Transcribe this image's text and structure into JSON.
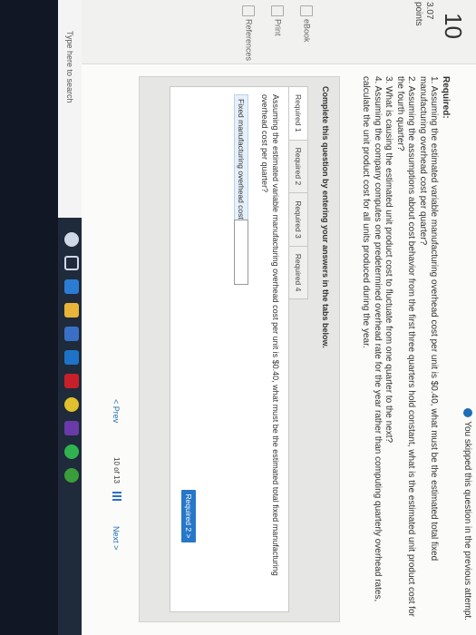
{
  "notice": "You skipped this question in the previous attempt.",
  "question": {
    "number": "10",
    "points": "3.07",
    "points_label": "points",
    "side_links": [
      "eBook",
      "Print",
      "References"
    ]
  },
  "required": {
    "heading": "Required:",
    "items": [
      "1. Assuming the estimated variable manufacturing overhead cost per unit is $0.40, what must be the estimated total fixed manufacturing overhead cost per quarter?",
      "2. Assuming the assumptions about cost behavior from the first three quarters hold constant, what is the estimated unit product cost for the fourth quarter?",
      "3. What is causing the estimated unit product cost to fluctuate from one quarter to the next?",
      "4. Assuming the company computes one predetermined overhead rate for the year rather than computing quarterly overhead rates, calculate the unit product cost for all units produced during the year."
    ]
  },
  "panel": {
    "instruction": "Complete this question by entering your answers in the tabs below.",
    "tabs": [
      "Required 1",
      "Required 2",
      "Required 3",
      "Required 4"
    ],
    "active_tab": 0,
    "question_text": "Assuming the estimated variable manufacturing overhead cost per unit is $0.40, what must be the estimated total fixed manufacturing overhead cost per quarter?",
    "field_label": "Fixed manufacturing overhead cost",
    "field_value": "",
    "next_tab_button": "Required 2  >"
  },
  "footer": {
    "prev": "< Prev",
    "page": "10",
    "of": "of",
    "total": "13",
    "next": "Next >"
  },
  "taskbar": {
    "search_placeholder": "Type here to search",
    "icons": [
      "cortana-icon",
      "task-view-icon",
      "edge-icon",
      "file-explorer-icon",
      "store-icon",
      "mail-icon",
      "mcgraw-hill-icon",
      "chrome-icon",
      "media-icon",
      "spotify-icon",
      "xbox-icon"
    ]
  },
  "colors": {
    "accent": "#2677c8",
    "taskbar": "#1f2a3a"
  }
}
